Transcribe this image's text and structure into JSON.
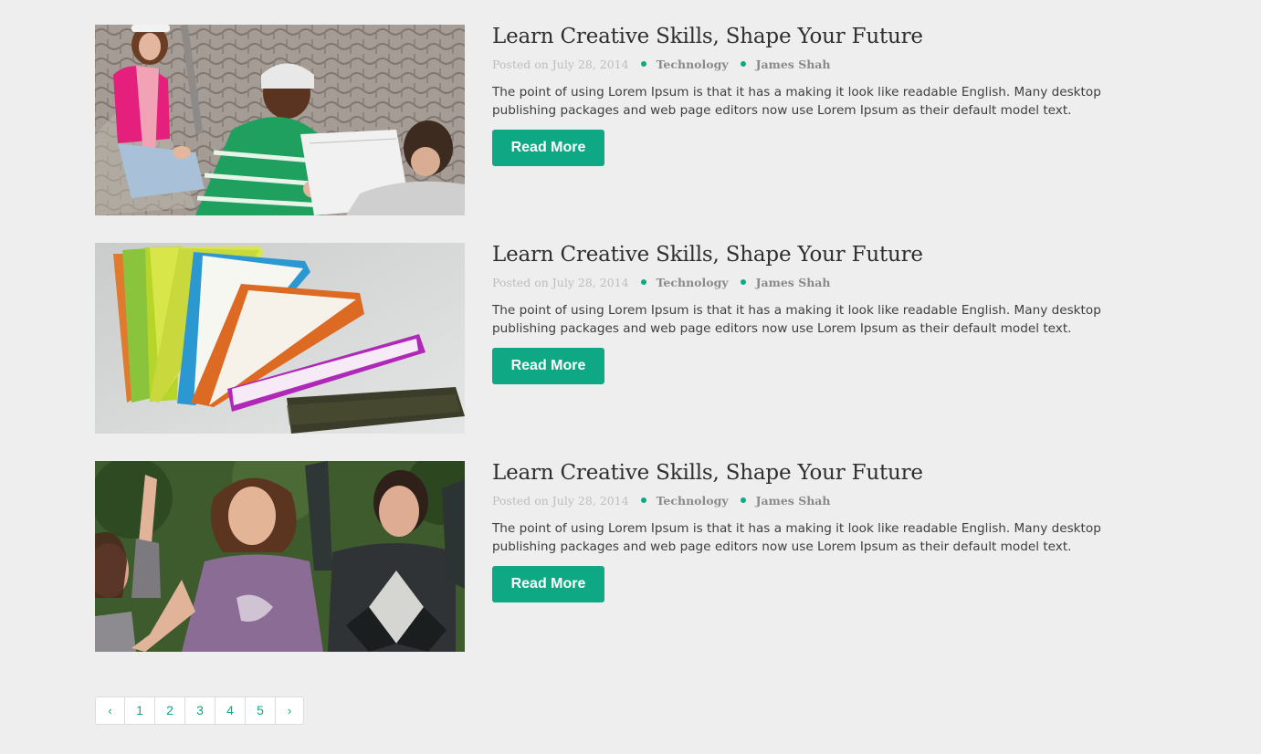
{
  "posts": [
    {
      "title": "Learn Creative Skills, Shape Your Future",
      "posted_on": "Posted on July 28, 2014",
      "category": "Technology",
      "author": "James Shah",
      "excerpt": "The point of using Lorem Ipsum is that it has a making it look like readable English. Many desktop publishing packages and web page editors now use Lorem Ipsum as their default model text.",
      "button": "Read More",
      "image": "students-studying-outdoors"
    },
    {
      "title": "Learn Creative Skills, Shape Your Future",
      "posted_on": "Posted on July 28, 2014",
      "category": "Technology",
      "author": "James Shah",
      "excerpt": "The point of using Lorem Ipsum is that it has a making it look like readable English. Many desktop publishing packages and web page editors now use Lorem Ipsum as their default model text.",
      "button": "Read More",
      "image": "colorful-books"
    },
    {
      "title": "Learn Creative Skills, Shape Your Future",
      "posted_on": "Posted on July 28, 2014",
      "category": "Technology",
      "author": "James Shah",
      "excerpt": "The point of using Lorem Ipsum is that it has a making it look like readable English. Many desktop publishing packages and web page editors now use Lorem Ipsum as their default model text.",
      "button": "Read More",
      "image": "happy-students-cheering"
    }
  ],
  "pagination": {
    "prev": "‹",
    "pages": [
      "1",
      "2",
      "3",
      "4",
      "5"
    ],
    "next": "›"
  },
  "colors": {
    "accent": "#0fa884",
    "background": "#eeeeee",
    "title": "#2f2f2f"
  }
}
